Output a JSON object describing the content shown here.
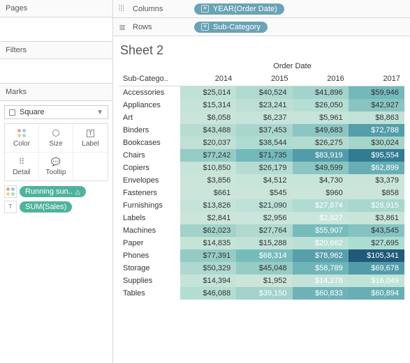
{
  "left": {
    "pages_label": "Pages",
    "filters_label": "Filters",
    "marks_label": "Marks",
    "mark_type": "Square",
    "mark_buttons": [
      "Color",
      "Size",
      "Label",
      "Detail",
      "Tooltip"
    ],
    "pill1": "Running sun..",
    "pill2": "SUM(Sales)"
  },
  "shelves": {
    "columns_label": "Columns",
    "rows_label": "Rows",
    "columns_pill": "YEAR(Order Date)",
    "rows_pill": "Sub-Category"
  },
  "sheet": {
    "title": "Sheet 2",
    "group_header": "Order Date",
    "row_header": "Sub-Catego..",
    "years": [
      "2014",
      "2015",
      "2016",
      "2017"
    ]
  },
  "chart_data": {
    "type": "heatmap",
    "title": "Sheet 2",
    "xlabel": "Order Date",
    "ylabel": "Sub-Category",
    "categories_x": [
      "2014",
      "2015",
      "2016",
      "2017"
    ],
    "categories_y": [
      "Accessories",
      "Appliances",
      "Art",
      "Binders",
      "Bookcases",
      "Chairs",
      "Copiers",
      "Envelopes",
      "Fasteners",
      "Furnishings",
      "Labels",
      "Machines",
      "Paper",
      "Phones",
      "Storage",
      "Supplies",
      "Tables"
    ],
    "values": [
      [
        25014,
        40524,
        41896,
        59946
      ],
      [
        15314,
        23241,
        26050,
        42927
      ],
      [
        6058,
        6237,
        5961,
        8863
      ],
      [
        43488,
        37453,
        49683,
        72788
      ],
      [
        20037,
        38544,
        26275,
        30024
      ],
      [
        77242,
        71735,
        83919,
        95554
      ],
      [
        10850,
        26179,
        49599,
        62899
      ],
      [
        3856,
        4512,
        4730,
        3379
      ],
      [
        661,
        545,
        960,
        858
      ],
      [
        13826,
        21090,
        27874,
        28915
      ],
      [
        2841,
        2956,
        2827,
        3861
      ],
      [
        62023,
        27764,
        55907,
        43545
      ],
      [
        14835,
        15288,
        20662,
        27695
      ],
      [
        77391,
        68314,
        78962,
        105341
      ],
      [
        50329,
        45048,
        58789,
        69678
      ],
      [
        14394,
        1952,
        14278,
        16049
      ],
      [
        46088,
        39150,
        60833,
        60894
      ]
    ],
    "display": [
      [
        "$25,014",
        "$40,524",
        "$41,896",
        "$59,946"
      ],
      [
        "$15,314",
        "$23,241",
        "$26,050",
        "$42,927"
      ],
      [
        "$6,058",
        "$6,237",
        "$5,961",
        "$8,863"
      ],
      [
        "$43,488",
        "$37,453",
        "$49,683",
        "$72,788"
      ],
      [
        "$20,037",
        "$38,544",
        "$26,275",
        "$30,024"
      ],
      [
        "$77,242",
        "$71,735",
        "$83,919",
        "$95,554"
      ],
      [
        "$10,850",
        "$26,179",
        "$49,599",
        "$62,899"
      ],
      [
        "$3,856",
        "$4,512",
        "$4,730",
        "$3,379"
      ],
      [
        "$661",
        "$545",
        "$960",
        "$858"
      ],
      [
        "$13,826",
        "$21,090",
        "$27,874",
        "$28,915"
      ],
      [
        "$2,841",
        "$2,956",
        "$2,827",
        "$3,861"
      ],
      [
        "$62,023",
        "$27,764",
        "$55,907",
        "$43,545"
      ],
      [
        "$14,835",
        "$15,288",
        "$20,662",
        "$27,695"
      ],
      [
        "$77,391",
        "$68,314",
        "$78,962",
        "$105,341"
      ],
      [
        "$50,329",
        "$45,048",
        "$58,789",
        "$69,678"
      ],
      [
        "$14,394",
        "$1,952",
        "$14,278",
        "$16,049"
      ],
      [
        "$46,088",
        "$39,150",
        "$60,833",
        "$60,894"
      ]
    ],
    "colors": [
      [
        "#bfe2d6",
        "#b0d9d0",
        "#a2d4cd",
        "#72b9bc"
      ],
      [
        "#c5e3d8",
        "#bddfd5",
        "#b5ded3",
        "#88c5c1"
      ],
      [
        "#cae4d9",
        "#c7e4da",
        "#c6e4d9",
        "#c1e2d8"
      ],
      [
        "#b7ddd2",
        "#a8d6cd",
        "#8cc6c3",
        "#539eaa"
      ],
      [
        "#c2e1d6",
        "#adddd1",
        "#b3dbd0",
        "#a5d4cb"
      ],
      [
        "#94cbc5",
        "#72b9bb",
        "#529ca9",
        "#317b93"
      ],
      [
        "#c7e4d9",
        "#b6dcd1",
        "#8bc6c2",
        "#67afb4"
      ],
      [
        "#cae5da",
        "#c8e5da",
        "#c7e5d9",
        "#c9e5da"
      ],
      [
        "#cbe5da",
        "#cbe5da",
        "#cbe5da",
        "#cbe5da"
      ],
      [
        "#c5e3d8",
        "#bde1d7",
        "#afdbd1",
        "#a7d7cd"
      ],
      [
        "#cbe5da",
        "#cae5da",
        "#cae5da",
        "#c8e5d9"
      ],
      [
        "#a2d2c9",
        "#b1d9cf",
        "#78bbbb",
        "#85c3c0"
      ],
      [
        "#c6e3d8",
        "#c2e2d7",
        "#bae0d5",
        "#acddd1"
      ],
      [
        "#95cbc5",
        "#77bcbd",
        "#579fab",
        "#205a79"
      ],
      [
        "#afd9d0",
        "#97ccc5",
        "#6eb5b9",
        "#529ca9"
      ],
      [
        "#c5e4d8",
        "#cbe5da",
        "#c3e3d8",
        "#bfe3d6"
      ],
      [
        "#b4ddd2",
        "#a2d2cb",
        "#6db3b8",
        "#67afb4"
      ]
    ],
    "text_light": [
      [
        false,
        false,
        false,
        false
      ],
      [
        false,
        false,
        false,
        false
      ],
      [
        false,
        false,
        false,
        false
      ],
      [
        false,
        false,
        false,
        true
      ],
      [
        false,
        false,
        false,
        false
      ],
      [
        false,
        false,
        true,
        true
      ],
      [
        false,
        false,
        false,
        true
      ],
      [
        false,
        false,
        false,
        false
      ],
      [
        false,
        false,
        false,
        false
      ],
      [
        false,
        false,
        true,
        true
      ],
      [
        false,
        false,
        true,
        false
      ],
      [
        false,
        false,
        true,
        false
      ],
      [
        false,
        false,
        true,
        false
      ],
      [
        false,
        true,
        true,
        true
      ],
      [
        false,
        false,
        true,
        true
      ],
      [
        false,
        false,
        true,
        true
      ],
      [
        false,
        true,
        true,
        true
      ]
    ]
  }
}
